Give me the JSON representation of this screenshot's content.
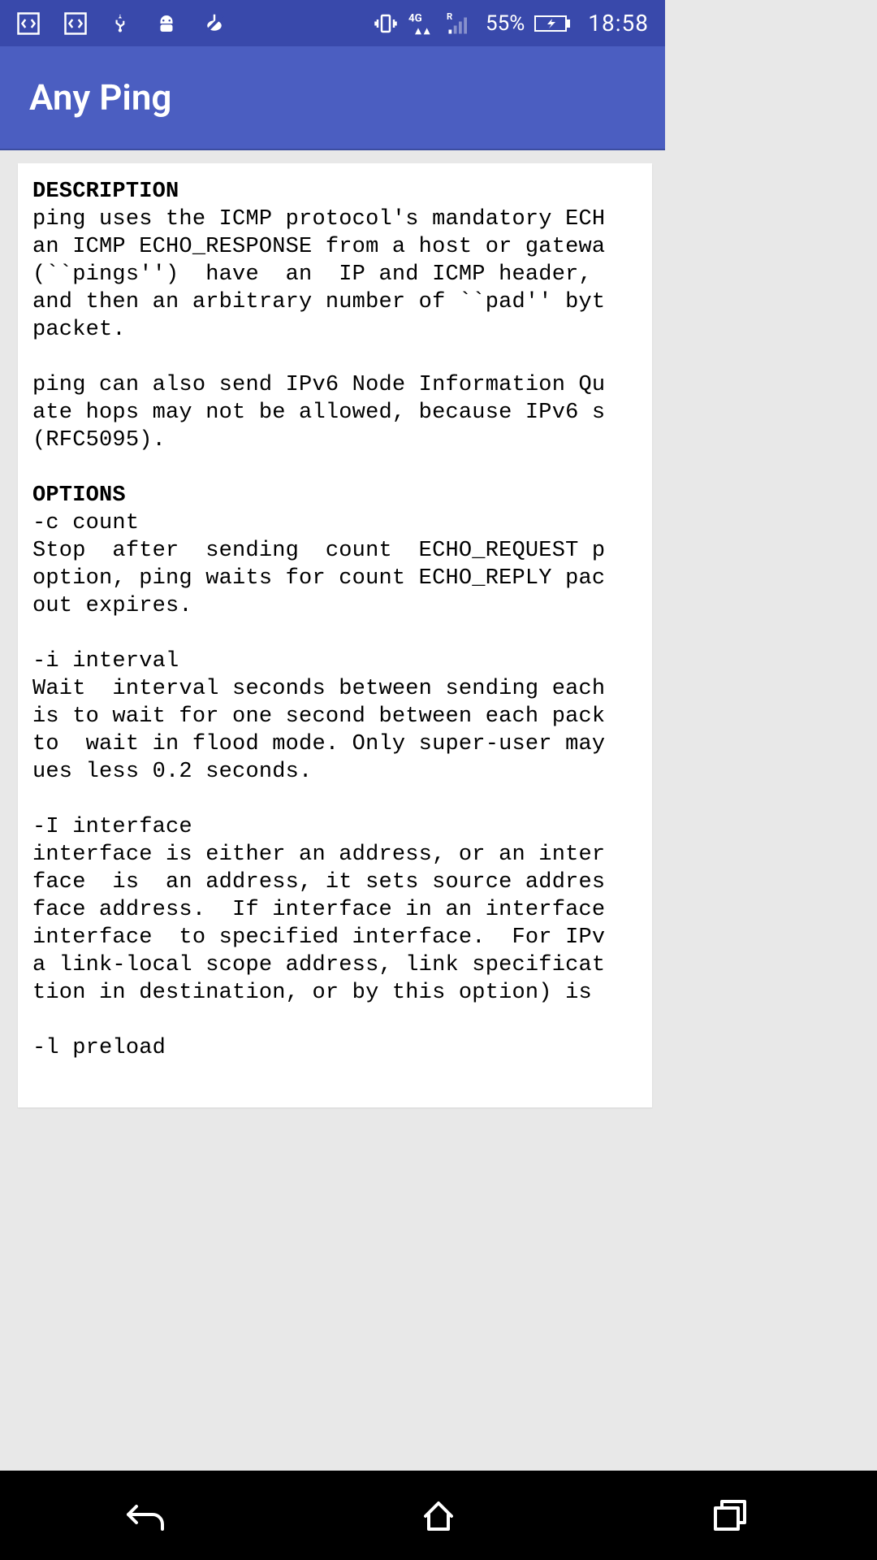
{
  "status": {
    "battery_pct": "55%",
    "time": "18:58",
    "net_label": "4G",
    "roaming": "R"
  },
  "app": {
    "title": "Any Ping"
  },
  "man": {
    "h_desc": "DESCRIPTION",
    "desc_l1": "ping uses the ICMP protocol's mandatory ECH",
    "desc_l2": "an ICMP ECHO_RESPONSE from a host or gatewa",
    "desc_l3": "(``pings'')  have  an  IP and ICMP header, ",
    "desc_l4": "and then an arbitrary number of ``pad'' byt",
    "desc_l5": "packet.",
    "desc_l6": "ping can also send IPv6 Node Information Qu",
    "desc_l7": "ate hops may not be allowed, because IPv6 s",
    "desc_l8": "(RFC5095).",
    "h_opt": "OPTIONS",
    "opt_c": "-c count",
    "opt_c1": "Stop  after  sending  count  ECHO_REQUEST p",
    "opt_c2": "option, ping waits for count ECHO_REPLY pac",
    "opt_c3": "out expires.",
    "opt_i": "-i interval",
    "opt_i1": "Wait  interval seconds between sending each",
    "opt_i2": "is to wait for one second between each pack",
    "opt_i3": "to  wait in flood mode. Only super-user may",
    "opt_i4": "ues less 0.2 seconds.",
    "opt_I": "-I interface",
    "opt_I1": "interface is either an address, or an inter",
    "opt_I2": "face  is  an address, it sets source addres",
    "opt_I3": "face address.  If interface in an interface",
    "opt_I4": "interface  to specified interface.  For IPv",
    "opt_I5": "a link-local scope address, link specificat",
    "opt_I6": "tion in destination, or by this option) is ",
    "opt_l": "-l preload"
  }
}
